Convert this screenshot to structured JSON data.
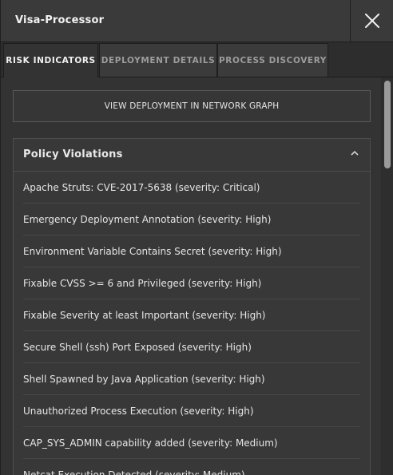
{
  "header": {
    "title": "Visa-Processor",
    "close_icon": "close-icon"
  },
  "tabs": [
    {
      "label": "RISK INDICATORS",
      "active": true
    },
    {
      "label": "DEPLOYMENT DETAILS",
      "active": false
    },
    {
      "label": "PROCESS DISCOVERY",
      "active": false
    }
  ],
  "main": {
    "view_button_label": "VIEW DEPLOYMENT IN NETWORK GRAPH",
    "policy_violations": {
      "title": "Policy Violations",
      "toggle_icon": "chevron-up-icon",
      "items": [
        "Apache Struts: CVE-2017-5638 (severity: Critical)",
        "Emergency Deployment Annotation (severity: High)",
        "Environment Variable Contains Secret (severity: High)",
        "Fixable CVSS >= 6 and Privileged (severity: High)",
        "Fixable Severity at least Important (severity: High)",
        "Secure Shell (ssh) Port Exposed (severity: High)",
        "Shell Spawned by Java Application (severity: High)",
        "Unauthorized Process Execution (severity: High)",
        "CAP_SYS_ADMIN capability added (severity: Medium)",
        "Netcat Execution Detected (severity: Medium)"
      ]
    }
  },
  "colors": {
    "background": "#333333",
    "header": "#3a3a3a",
    "text": "#e6e6e6",
    "muted_tab_text": "#9c9c9c"
  }
}
